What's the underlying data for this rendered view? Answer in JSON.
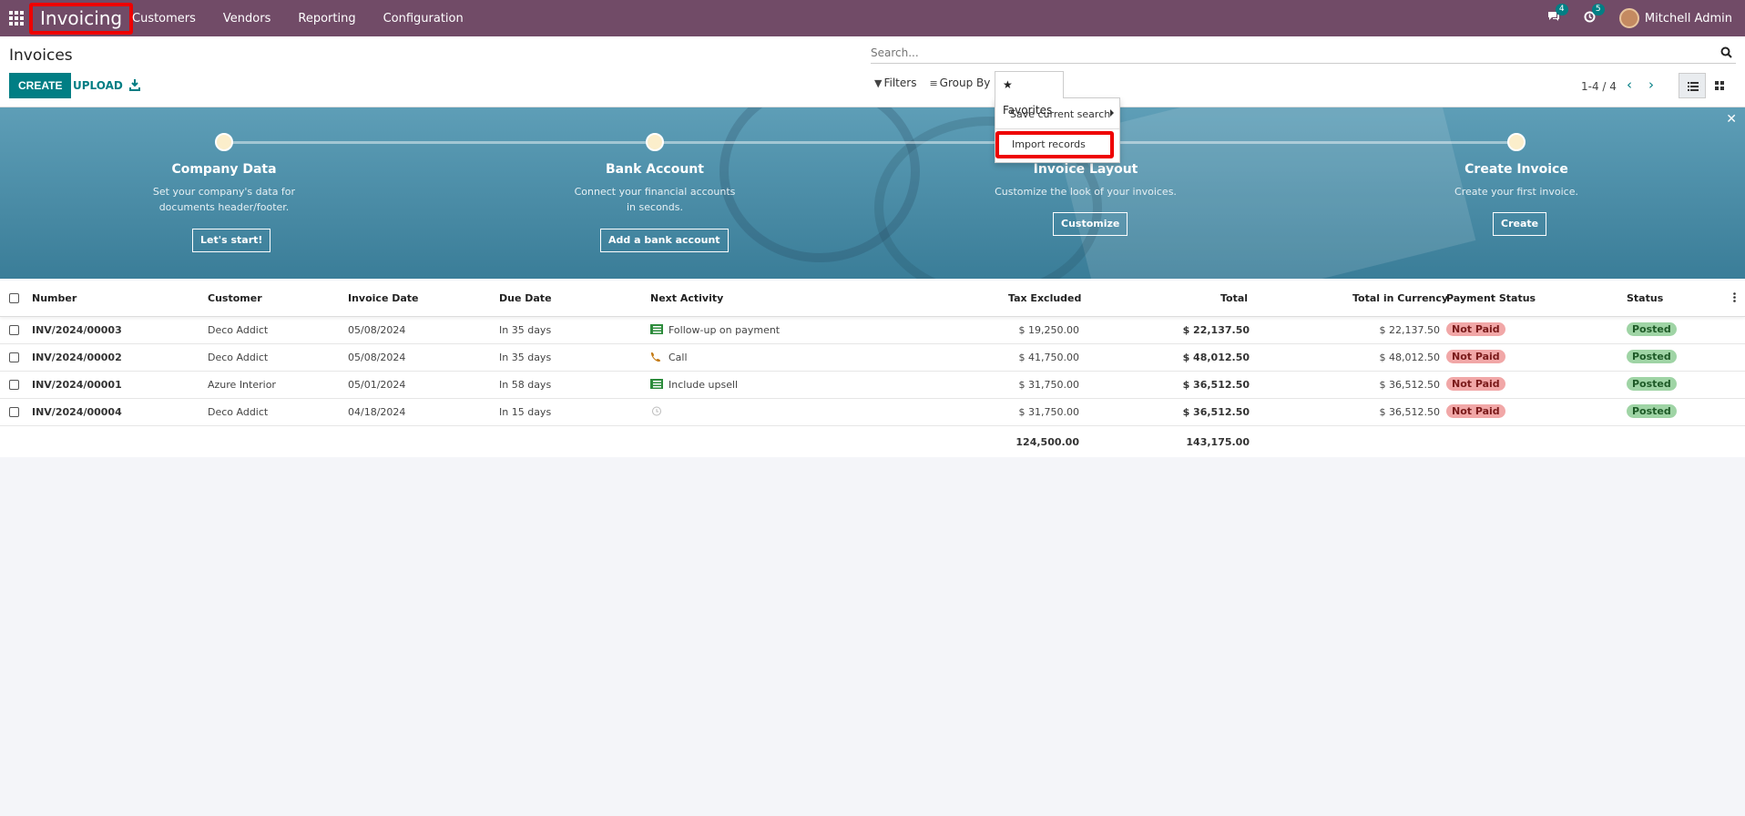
{
  "topbar": {
    "app_name": "Invoicing",
    "menu": [
      "Customers",
      "Vendors",
      "Reporting",
      "Configuration"
    ],
    "messages_count": "4",
    "activities_count": "5",
    "user_name": "Mitchell Admin"
  },
  "control_panel": {
    "title": "Invoices",
    "create_label": "CREATE",
    "upload_label": "UPLOAD",
    "search_placeholder": "Search...",
    "filters_label": "Filters",
    "groupby_label": "Group By",
    "favorites_label": "Favorites",
    "pager": "1-4 / 4"
  },
  "favorites_menu": {
    "save_search": "Save current search",
    "import_records": "Import records"
  },
  "banner": {
    "steps": [
      {
        "title": "Company Data",
        "desc": "Set your company's data for documents header/footer.",
        "button": "Let's start!"
      },
      {
        "title": "Bank Account",
        "desc": "Connect your financial accounts in seconds.",
        "button": "Add a bank account"
      },
      {
        "title": "Invoice Layout",
        "desc": "Customize the look of your invoices.",
        "button": "Customize"
      },
      {
        "title": "Create Invoice",
        "desc": "Create your first invoice.",
        "button": "Create"
      }
    ]
  },
  "table": {
    "columns": [
      "Number",
      "Customer",
      "Invoice Date",
      "Due Date",
      "Next Activity",
      "Tax Excluded",
      "Total",
      "Total in Currency",
      "Payment Status",
      "Status"
    ],
    "rows": [
      {
        "number": "INV/2024/00003",
        "customer": "Deco Addict",
        "invoice_date": "05/08/2024",
        "due_date": "In 35 days",
        "activity": "Follow-up on payment",
        "activity_icon": "todo-icon",
        "tax_excluded": "$ 19,250.00",
        "total": "$ 22,137.50",
        "total_currency": "$ 22,137.50",
        "payment_status": "Not Paid",
        "status": "Posted"
      },
      {
        "number": "INV/2024/00002",
        "customer": "Deco Addict",
        "invoice_date": "05/08/2024",
        "due_date": "In 35 days",
        "activity": "Call",
        "activity_icon": "phone-icon",
        "tax_excluded": "$ 41,750.00",
        "total": "$ 48,012.50",
        "total_currency": "$ 48,012.50",
        "payment_status": "Not Paid",
        "status": "Posted"
      },
      {
        "number": "INV/2024/00001",
        "customer": "Azure Interior",
        "invoice_date": "05/01/2024",
        "due_date": "In 58 days",
        "activity": "Include upsell",
        "activity_icon": "todo-icon",
        "tax_excluded": "$ 31,750.00",
        "total": "$ 36,512.50",
        "total_currency": "$ 36,512.50",
        "payment_status": "Not Paid",
        "status": "Posted"
      },
      {
        "number": "INV/2024/00004",
        "customer": "Deco Addict",
        "invoice_date": "04/18/2024",
        "due_date": "In 15 days",
        "activity": "",
        "activity_icon": "clock-icon",
        "tax_excluded": "$ 31,750.00",
        "total": "$ 36,512.50",
        "total_currency": "$ 36,512.50",
        "payment_status": "Not Paid",
        "status": "Posted"
      }
    ],
    "totals": {
      "tax_excluded": "124,500.00",
      "total": "143,175.00"
    }
  },
  "colors": {
    "brand": "#714b67",
    "accent": "#017e84",
    "not_paid": "#f1a7a7",
    "posted": "#9fd4a5",
    "highlight": "#e00000"
  }
}
